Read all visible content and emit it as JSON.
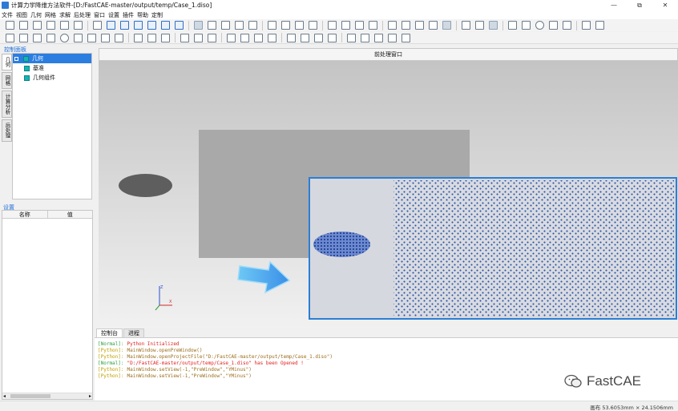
{
  "window": {
    "title": "计算力学降维方法软件-[D:/FastCAE-master/output/temp/Case_1.diso]",
    "minimize": "—",
    "restore": "⧉",
    "close": "✕"
  },
  "menu": [
    "文件",
    "视图",
    "几何",
    "网格",
    "求解",
    "后处理",
    "窗口",
    "设置",
    "插件",
    "帮助",
    "定制"
  ],
  "left_panel": {
    "title": "控制面板",
    "side_tabs": [
      "几何",
      "网格",
      "计算分析",
      "后处理"
    ],
    "tree": {
      "root": "几何",
      "children": [
        "基准",
        "几何组件"
      ]
    },
    "settings_title": "设置",
    "columns": [
      "名称",
      "值"
    ]
  },
  "viewer": {
    "title": "前处理窗口"
  },
  "console": {
    "tabs": [
      "控制台",
      "进程"
    ],
    "lines": [
      {
        "tag": "[Normal]:",
        "msg": "Python Initialized"
      },
      {
        "tag": "[Python]:",
        "msg": "MainWindow.openPreWindow()"
      },
      {
        "tag": "[Python]:",
        "msg": "MainWindow.openProjectFile(\"D:/FastCAE-master/output/temp/Case_1.diso\")"
      },
      {
        "tag": "[Normal]:",
        "msg": "\"D:/FastCAE-master/output/temp/Case_1.diso\" has been Opened !"
      },
      {
        "tag": "[Python]:",
        "msg": "MainWindow.setView(-1,\"PreWindow\",\"YMinus\")"
      },
      {
        "tag": "[Python]:",
        "msg": "MainWindow.setView(-1,\"PreWindow\",\"YMinus\")"
      }
    ]
  },
  "watermark": "FastCAE",
  "status": "画布  53.6053mm × 24.1506mm",
  "colors": {
    "accent": "#2b7de0",
    "tree_cube": "#16b3b3",
    "normal_tag": "#2ea043",
    "python_tag": "#c0a000",
    "error_text": "#e02020"
  }
}
